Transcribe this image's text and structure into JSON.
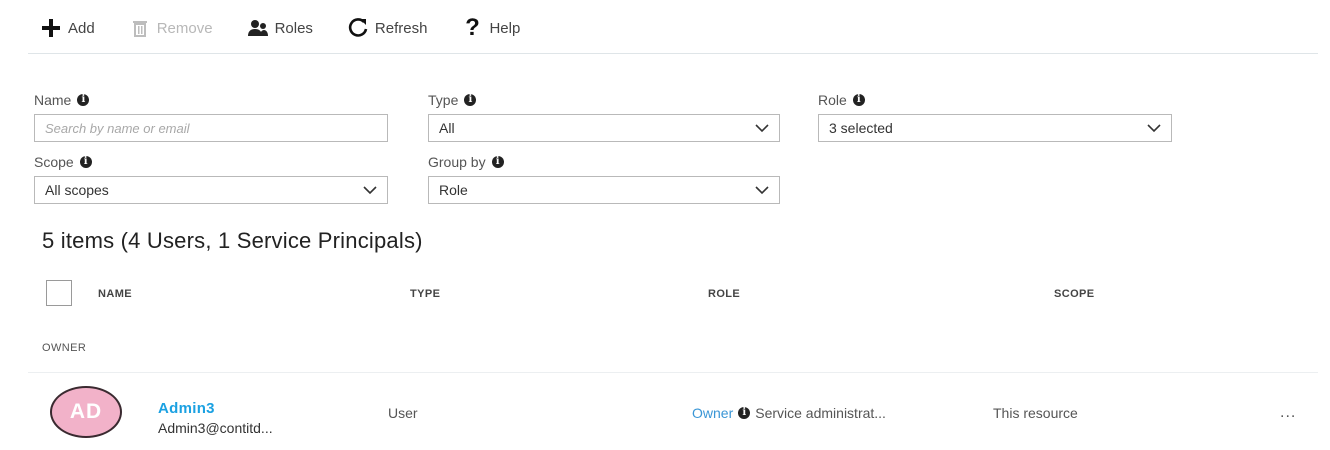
{
  "toolbar": {
    "add": "Add",
    "remove": "Remove",
    "roles": "Roles",
    "refresh": "Refresh",
    "help": "Help"
  },
  "filters": {
    "name": {
      "label": "Name",
      "placeholder": "Search by name or email"
    },
    "type": {
      "label": "Type",
      "value": "All"
    },
    "role": {
      "label": "Role",
      "value": "3 selected"
    },
    "scope": {
      "label": "Scope",
      "value": "All scopes"
    },
    "group_by": {
      "label": "Group by",
      "value": "Role"
    }
  },
  "summary": "5 items (4 Users, 1 Service Principals)",
  "columns": [
    "NAME",
    "TYPE",
    "ROLE",
    "SCOPE"
  ],
  "group": "OWNER",
  "rows": [
    {
      "initials": "AD",
      "name": "Admin3",
      "email": "Admin3@contitd...",
      "type": "User",
      "role_link": "Owner",
      "role_detail": "Service administrat...",
      "scope": "This resource",
      "more": "..."
    }
  ],
  "colors": {
    "accent": "#1ba1e2",
    "avatar_bg": "#f2b2c9"
  }
}
